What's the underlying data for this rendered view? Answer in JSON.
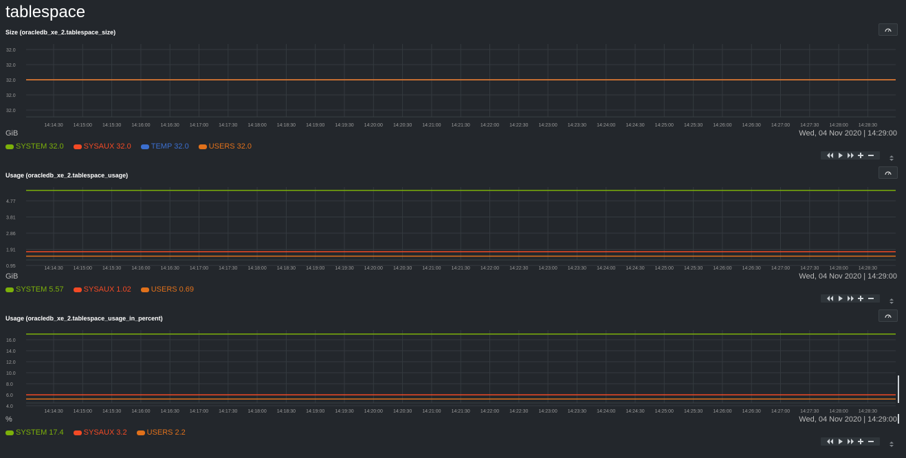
{
  "page": {
    "title": "tablespace"
  },
  "time_axis": {
    "ticks": [
      "14:14:30",
      "14:15:00",
      "14:15:30",
      "14:16:00",
      "14:16:30",
      "14:17:00",
      "14:17:30",
      "14:18:00",
      "14:18:30",
      "14:19:00",
      "14:19:30",
      "14:20:00",
      "14:20:30",
      "14:21:00",
      "14:21:30",
      "14:22:00",
      "14:22:30",
      "14:23:00",
      "14:23:30",
      "14:24:00",
      "14:24:30",
      "14:25:00",
      "14:25:30",
      "14:26:00",
      "14:26:30",
      "14:27:00",
      "14:27:30",
      "14:28:00",
      "14:28:30"
    ],
    "timestamp": "Wed, 04 Nov 2020 | 14:29:00"
  },
  "colors": {
    "SYSTEM": "#7cb00a",
    "SYSAUX": "#f34a25",
    "TEMP": "#3b6fcf",
    "USERS": "#e1711b"
  },
  "icons": {
    "reset": "reset-zoom-icon",
    "controls": [
      "rewind-icon",
      "play-icon",
      "fast-forward-icon",
      "zoom-in-icon",
      "zoom-out-icon"
    ],
    "resize": "resize-handle-icon"
  },
  "charts": [
    {
      "title": "Size (oracledb_xe_2.tablespace_size)",
      "units": "GiB",
      "yticks": [
        "32.0",
        "32.0",
        "32.0",
        "32.0",
        "32.0"
      ],
      "legend": [
        {
          "name": "SYSTEM",
          "value": "32.0"
        },
        {
          "name": "SYSAUX",
          "value": "32.0"
        },
        {
          "name": "TEMP",
          "value": "32.0"
        },
        {
          "name": "USERS",
          "value": "32.0"
        }
      ]
    },
    {
      "title": "Usage (oracledb_xe_2.tablespace_usage)",
      "units": "GiB",
      "yticks": [
        "4.77",
        "3.81",
        "2.86",
        "1.91",
        "0.95"
      ],
      "legend": [
        {
          "name": "SYSTEM",
          "value": "5.57"
        },
        {
          "name": "SYSAUX",
          "value": "1.02"
        },
        {
          "name": "USERS",
          "value": "0.69"
        }
      ]
    },
    {
      "title": "Usage (oracledb_xe_2.tablespace_usage_in_percent)",
      "units": "%",
      "yticks": [
        "16.0",
        "14.0",
        "12.0",
        "10.0",
        "8.0",
        "6.0",
        "4.0"
      ],
      "legend": [
        {
          "name": "SYSTEM",
          "value": "17.4"
        },
        {
          "name": "SYSAUX",
          "value": "3.2"
        },
        {
          "name": "USERS",
          "value": "2.2"
        }
      ]
    }
  ],
  "chart_data": [
    {
      "type": "line",
      "title": "Size (oracledb_xe_2.tablespace_size)",
      "ylabel": "GiB",
      "x": [
        "14:14:30",
        "14:29:00"
      ],
      "series": [
        {
          "name": "SYSTEM",
          "values": [
            32.0,
            32.0
          ]
        },
        {
          "name": "SYSAUX",
          "values": [
            32.0,
            32.0
          ]
        },
        {
          "name": "TEMP",
          "values": [
            32.0,
            32.0
          ]
        },
        {
          "name": "USERS",
          "values": [
            32.0,
            32.0
          ]
        }
      ]
    },
    {
      "type": "line",
      "title": "Usage (oracledb_xe_2.tablespace_usage)",
      "ylabel": "GiB",
      "ylim": [
        0,
        5.72
      ],
      "x": [
        "14:14:30",
        "14:29:00"
      ],
      "series": [
        {
          "name": "SYSTEM",
          "values": [
            5.57,
            5.57
          ]
        },
        {
          "name": "SYSAUX",
          "values": [
            1.02,
            1.02
          ]
        },
        {
          "name": "USERS",
          "values": [
            0.69,
            0.69
          ]
        }
      ]
    },
    {
      "type": "line",
      "title": "Usage (oracledb_xe_2.tablespace_usage_in_percent)",
      "ylabel": "%",
      "ylim": [
        0,
        18
      ],
      "x": [
        "14:14:30",
        "14:29:00"
      ],
      "series": [
        {
          "name": "SYSTEM",
          "values": [
            17.4,
            17.4
          ]
        },
        {
          "name": "SYSAUX",
          "values": [
            3.2,
            3.2
          ]
        },
        {
          "name": "USERS",
          "values": [
            2.2,
            2.2
          ]
        }
      ]
    }
  ]
}
